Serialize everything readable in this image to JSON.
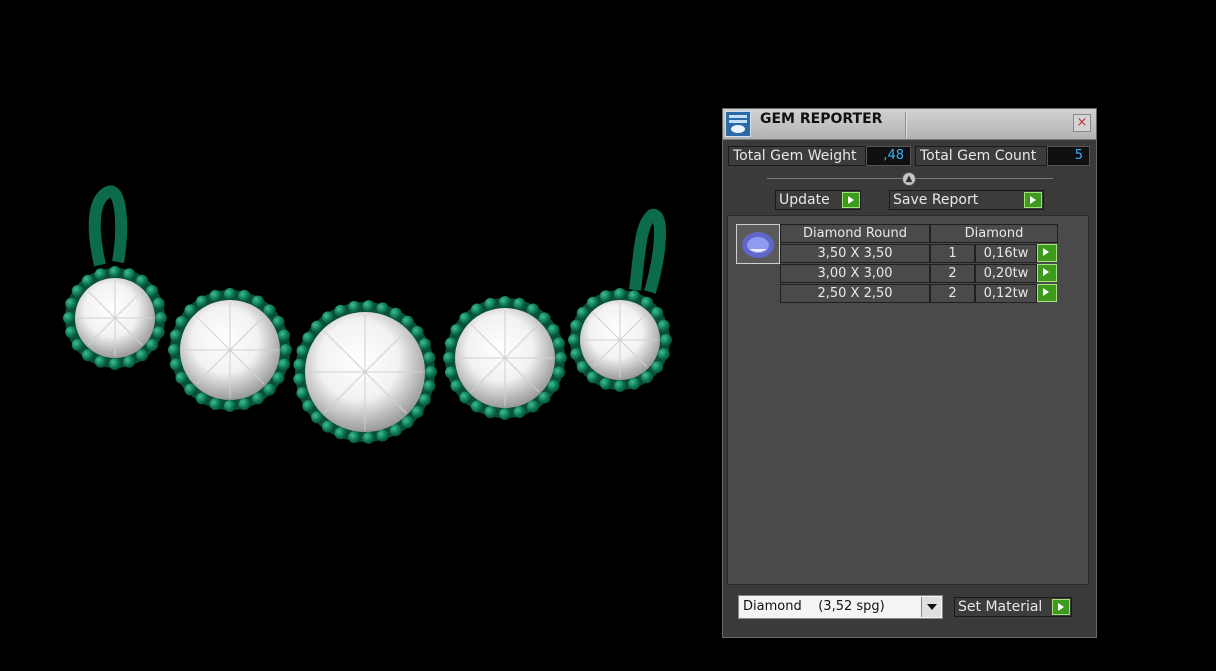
{
  "panel": {
    "title": "GEM REPORTER",
    "close_label": "×",
    "total_weight_label": "Total Gem Weight",
    "total_weight_value": ",48",
    "total_count_label": "Total Gem Count",
    "total_count_value": "5",
    "update_label": "Update",
    "save_report_label": "Save Report",
    "table": {
      "headers": [
        "Diamond Round",
        "Diamond"
      ],
      "rows": [
        {
          "size": "3,50 X 3,50",
          "count": "1",
          "weight": "0,16tw"
        },
        {
          "size": "3,00 X 3,00",
          "count": "2",
          "weight": "0,20tw"
        },
        {
          "size": "2,50 X 2,50",
          "count": "2",
          "weight": "0,12tw"
        }
      ]
    },
    "material_select": {
      "value": "Diamond    (3,52 spg)"
    },
    "set_material_label": "Set Material"
  },
  "colors": {
    "prong_green": "#0e7a55",
    "accent_button": "#3d9a1d",
    "value_text": "#37b3ff",
    "panel_bg": "#3a3a3a"
  },
  "icons": [
    "gem-reporter-app-icon",
    "close-icon",
    "collapse-knob-icon",
    "play-arrow-icon",
    "round-gem-icon",
    "dropdown-arrow-icon"
  ]
}
